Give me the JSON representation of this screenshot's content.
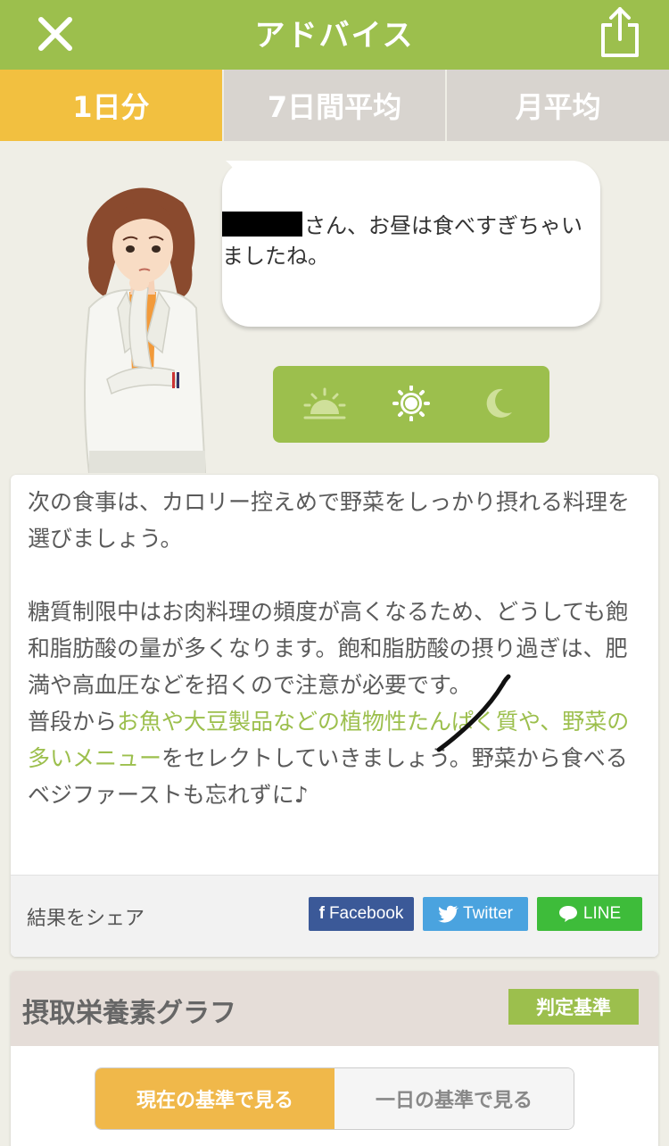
{
  "header": {
    "title": "アドバイス"
  },
  "tabs": [
    {
      "label": "1日分",
      "active": true
    },
    {
      "label": "7日間平均",
      "active": false
    },
    {
      "label": "月平均",
      "active": false
    }
  ],
  "bubble": {
    "message": "さん、お昼は食べすぎちゃいましたね。"
  },
  "meal_times": [
    "sunrise-icon",
    "sun-icon",
    "moon-icon"
  ],
  "advice": {
    "paragraph1": "次の食事は、カロリー控えめで野菜をしっかり摂れる料理を選びましょう。",
    "paragraph2": "糖質制限中はお肉料理の頻度が高くなるため、どうしても飽和脂肪酸の量が多くなります。飽和脂肪酸の摂り過ぎは、肥満や高血圧などを招くので注意が必要です。",
    "p3_prefix": "普段から",
    "p3_highlight": "お魚や大豆製品などの植物性たんぱく質や、野菜の多いメニュー",
    "p3_suffix": "をセレクトしていきましょう。野菜から食べるベジファーストも忘れずに♪"
  },
  "share": {
    "label": "結果をシェア",
    "facebook": "Facebook",
    "twitter": "Twitter",
    "line": "LINE"
  },
  "graph": {
    "title": "摂取栄養素グラフ",
    "criteria_button": "判定基準",
    "view_current": "現在の基準で見る",
    "view_daily": "一日の基準で見る"
  },
  "colors": {
    "header_green": "#9cbf4d",
    "tab_active": "#f2c040",
    "highlight_green": "#9cbf4d",
    "segment_active": "#f0b84a"
  }
}
